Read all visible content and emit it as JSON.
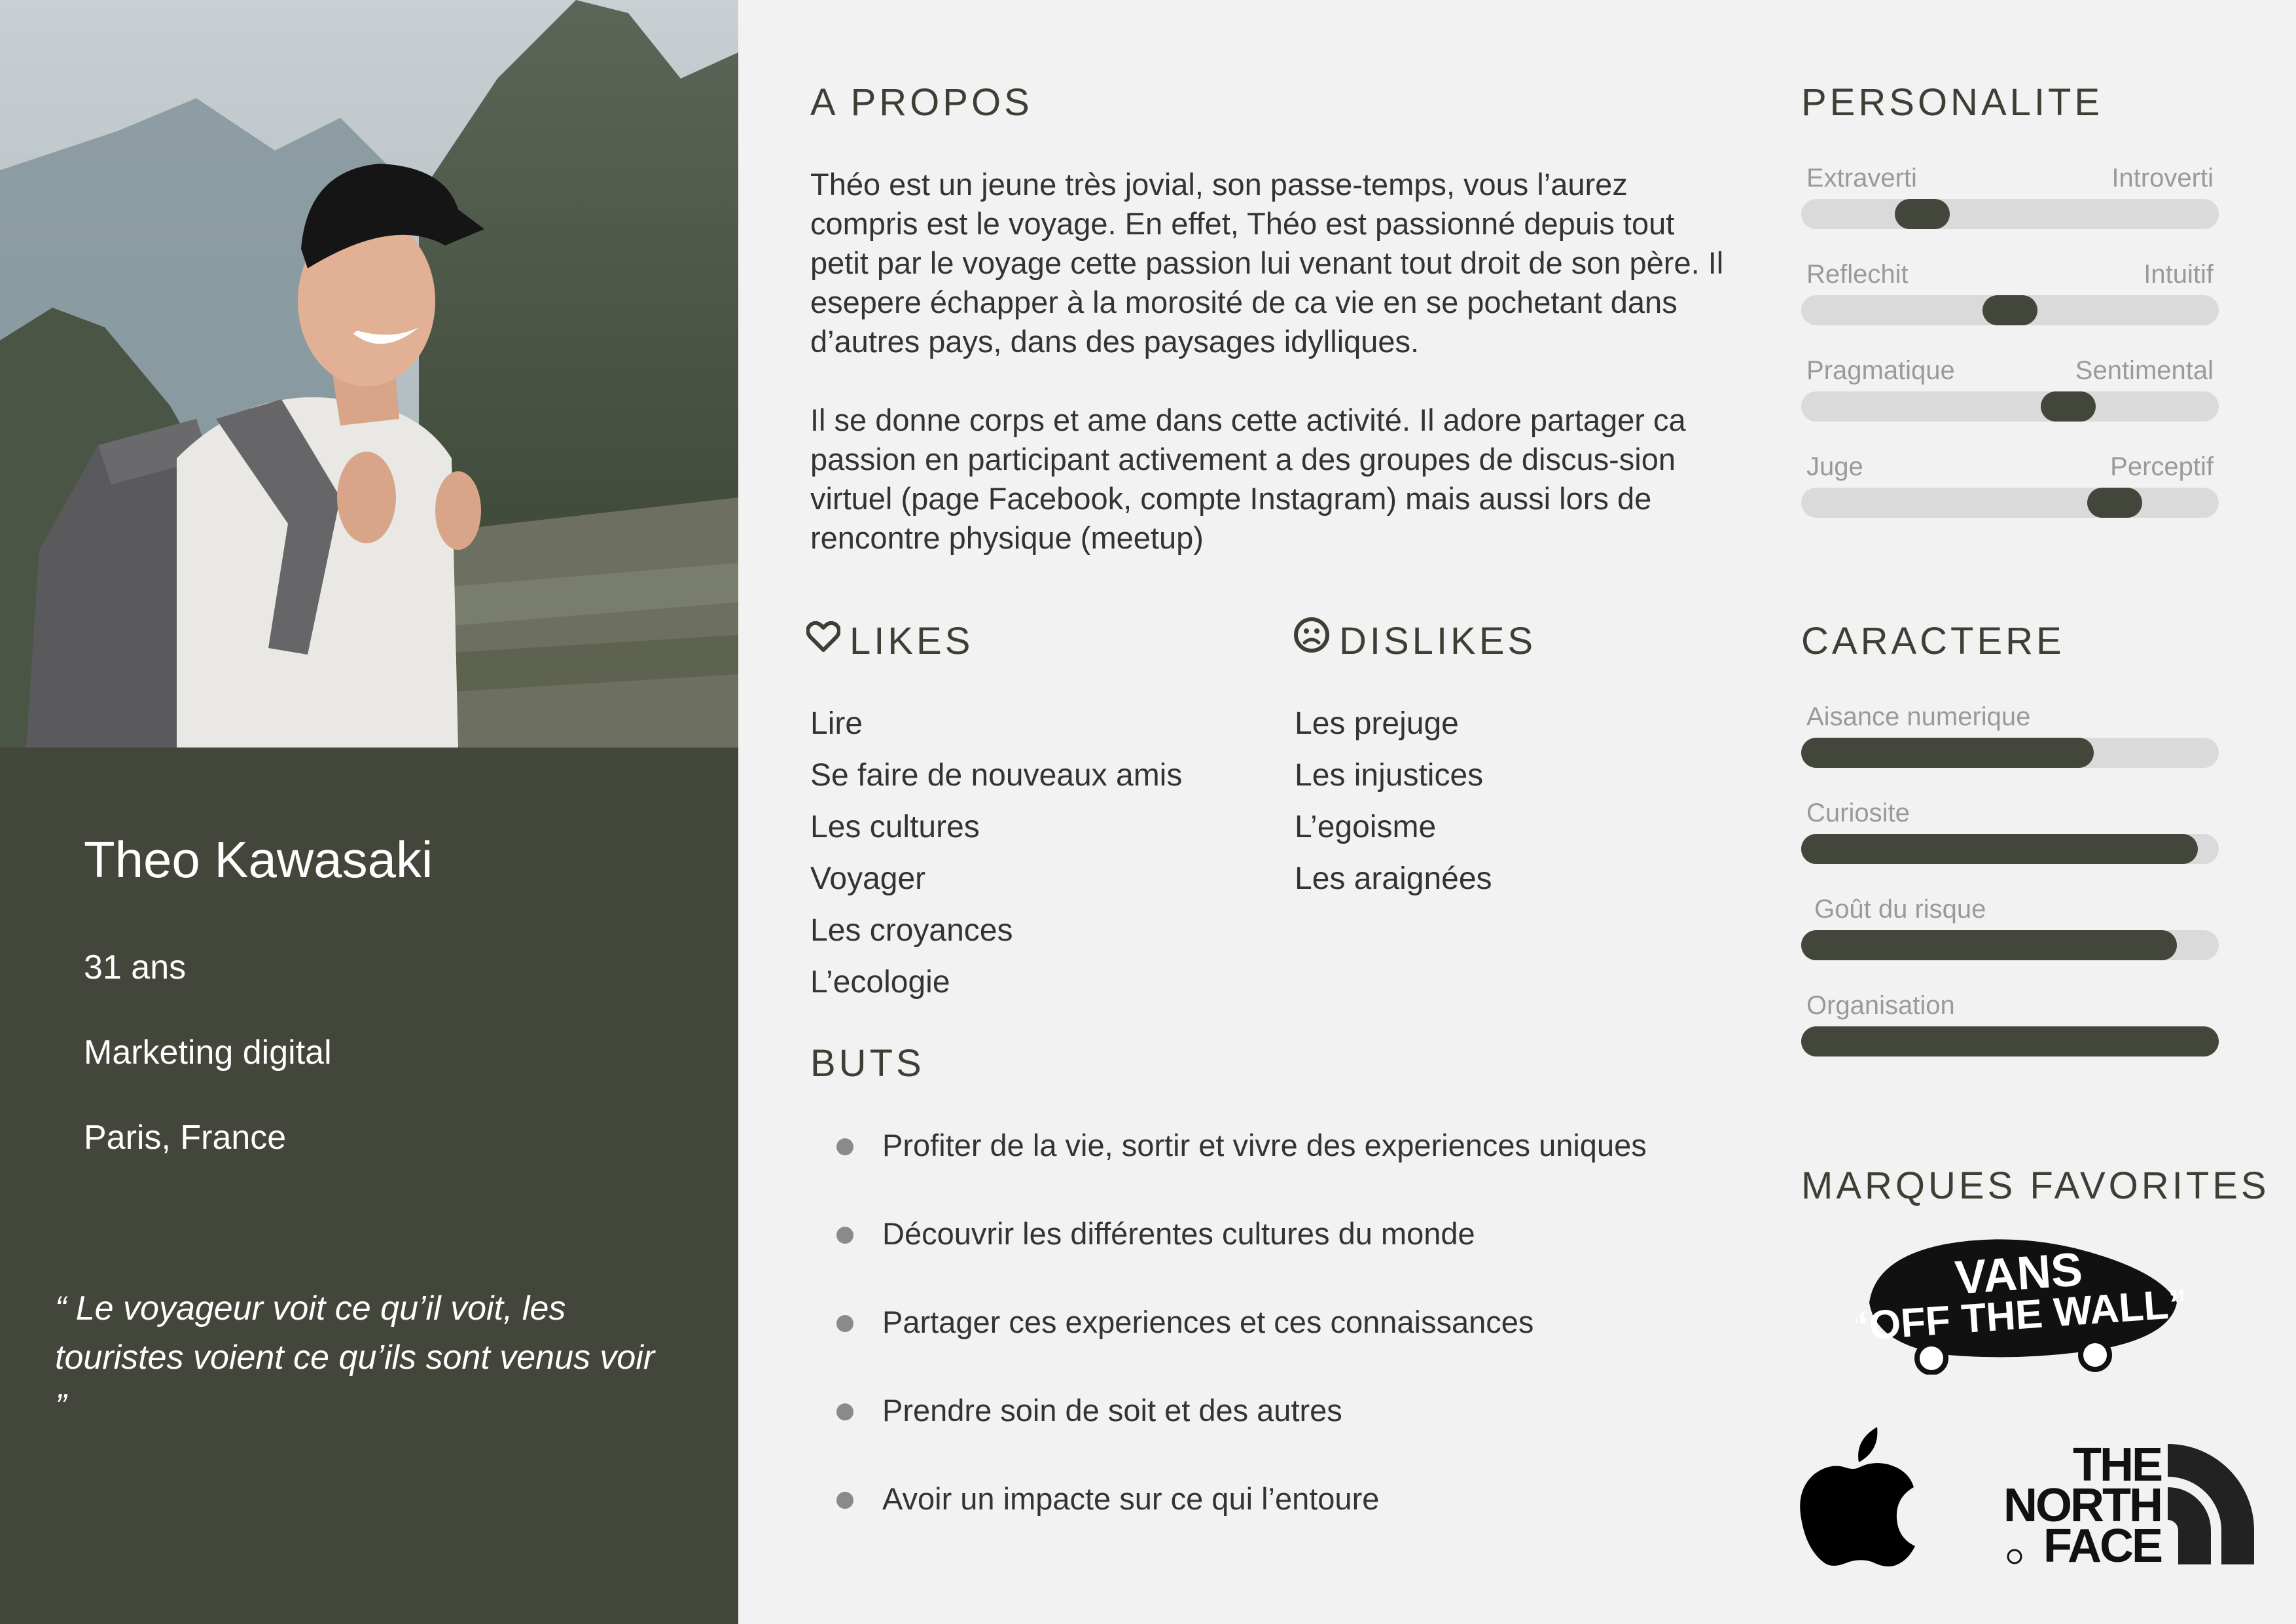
{
  "profile": {
    "name": "Theo Kawasaki",
    "age": "31 ans",
    "job": "Marketing digital",
    "location": "Paris, France",
    "quote": "“ Le voyageur voit ce qu’il voit, les touristes voient ce qu’ils sont venus voir ”"
  },
  "about": {
    "title": "A PROPOS",
    "paragraphs": [
      "Théo est un jeune très jovial, son passe-temps, vous l’aurez compris est le voyage. En effet, Théo est passionné depuis tout petit par le voyage cette passion lui venant tout droit de son père. Il esepere échapper à la morosité de ca vie en se pochetant dans d’autres pays, dans des paysages idylliques.",
      "Il se donne corps et ame dans cette activité. Il adore partager ca passion en participant activement a des groupes de discus-sion virtuel (page Facebook, compte Instagram) mais aussi lors de rencontre physique (meetup)"
    ]
  },
  "likes": {
    "title": "LIKES",
    "icon": "heart-icon",
    "items": [
      "Lire",
      "Se faire de nouveaux amis",
      "Les cultures",
      "Voyager",
      "Les croyances",
      "L’ecologie"
    ]
  },
  "dislikes": {
    "title": "DISLIKES",
    "icon": "sad-face-icon",
    "items": [
      "Les prejuge",
      "Les injustices",
      "L’egoisme",
      "Les araignées"
    ]
  },
  "goals": {
    "title": "BUTS",
    "items": [
      "Profiter de la vie, sortir et vivre des experiences uniques",
      "Découvrir les différentes cultures du monde",
      "Partager ces experiences et ces connaissances",
      "Prendre soin de soit et des autres",
      "Avoir un impacte sur ce qui l’entoure"
    ]
  },
  "personality": {
    "title": "PERSONALITE",
    "scales": [
      {
        "left": "Extraverti",
        "right": "Introverti",
        "value": 0.29
      },
      {
        "left": "Reflechit",
        "right": "Intuitif",
        "value": 0.5
      },
      {
        "left": "Pragmatique",
        "right": "Sentimental",
        "value": 0.64
      },
      {
        "left": "Juge",
        "right": "Perceptif",
        "value": 0.75
      }
    ]
  },
  "character": {
    "title": "CARACTERE",
    "traits": [
      {
        "label": "Aisance numerique",
        "value": 0.7
      },
      {
        "label": "Curiosite",
        "value": 0.95
      },
      {
        "label": "Goût du risque",
        "value": 0.9
      },
      {
        "label": "Organisation",
        "value": 1.0
      }
    ]
  },
  "brands": {
    "title": "MARQUES FAVORITES",
    "vans_line1": "VANS",
    "vans_line2": "“OFF THE WALL”",
    "tnf_line1": "THE",
    "tnf_line2": "NORTH",
    "tnf_line3": "FACE",
    "items": [
      "vans-logo",
      "apple-logo",
      "the-north-face-logo"
    ]
  },
  "colors": {
    "panel": "#43463a",
    "background": "#f2f2f2",
    "track": "#dadada"
  }
}
